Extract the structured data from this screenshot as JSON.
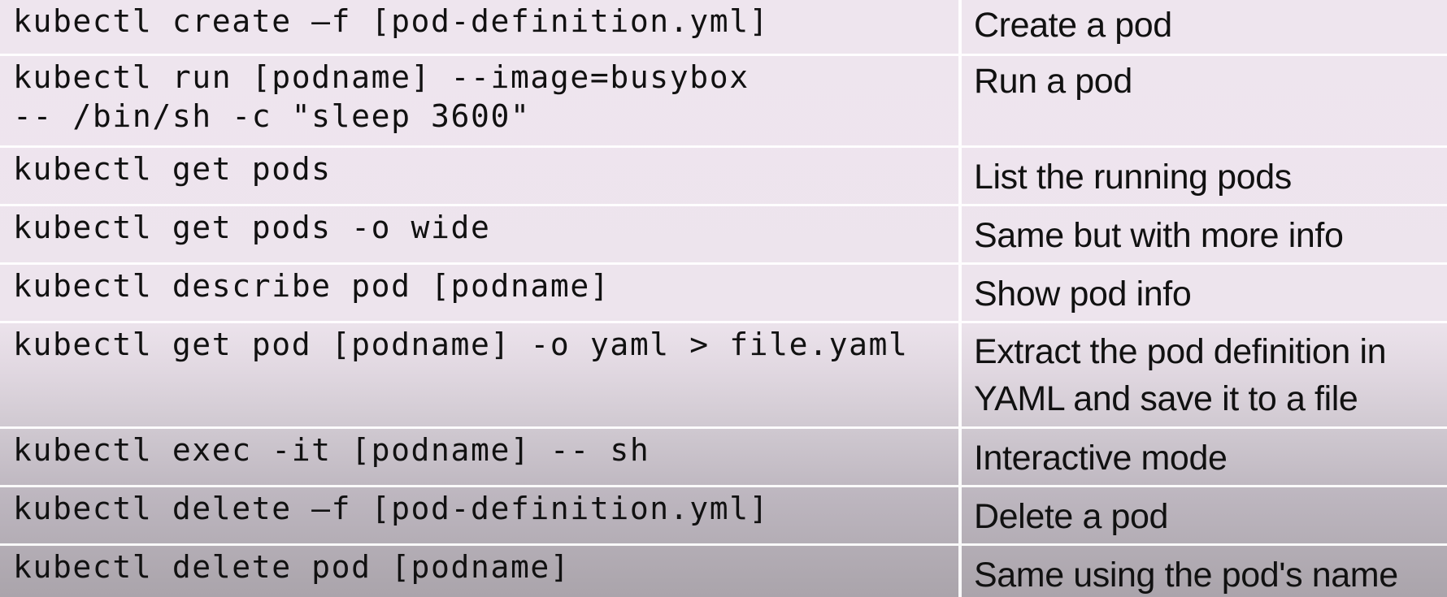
{
  "table": {
    "rows": [
      {
        "command": "kubectl create –f [pod-definition.yml]",
        "description": "Create a pod"
      },
      {
        "command": "kubectl run [podname] --image=busybox\n-- /bin/sh -c \"sleep 3600\"",
        "description": "Run a pod"
      },
      {
        "command": "kubectl get pods",
        "description": "List the running pods"
      },
      {
        "command": "kubectl get pods -o wide",
        "description": "Same but with more info"
      },
      {
        "command": "kubectl describe pod [podname]",
        "description": "Show pod info"
      },
      {
        "command": "kubectl get pod [podname] -o yaml > file.yaml",
        "description": "Extract the pod definition in\nYAML and save it to a file"
      },
      {
        "command": "kubectl exec -it [podname] -- sh",
        "description": "Interactive mode"
      },
      {
        "command": "kubectl delete –f [pod-definition.yml]",
        "description": "Delete a pod"
      },
      {
        "command": "kubectl delete pod [podname]",
        "description": "Same using the pod's name"
      }
    ]
  }
}
